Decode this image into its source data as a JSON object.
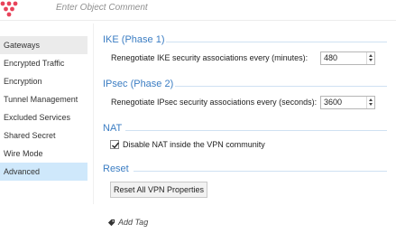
{
  "header": {
    "comment_placeholder": "Enter Object Comment"
  },
  "sidebar": {
    "items": [
      {
        "label": "Gateways",
        "state": "hover"
      },
      {
        "label": "Encrypted Traffic",
        "state": "normal"
      },
      {
        "label": "Encryption",
        "state": "normal"
      },
      {
        "label": "Tunnel Management",
        "state": "normal"
      },
      {
        "label": "Excluded Services",
        "state": "normal"
      },
      {
        "label": "Shared Secret",
        "state": "normal"
      },
      {
        "label": "Wire Mode",
        "state": "normal"
      },
      {
        "label": "Advanced",
        "state": "selected"
      }
    ]
  },
  "ike": {
    "title": "IKE (Phase 1)",
    "label": "Renegotiate IKE security associations every (minutes):",
    "value": "480"
  },
  "ipsec": {
    "title": "IPsec (Phase 2)",
    "label": "Renegotiate IPsec security associations every (seconds):",
    "value": "3600"
  },
  "nat": {
    "title": "NAT",
    "checkbox_label": "Disable NAT inside the VPN community",
    "checked": true
  },
  "reset": {
    "title": "Reset",
    "button_label": "Reset All VPN Properties"
  },
  "tags": {
    "add_label": "Add Tag"
  },
  "colors": {
    "accent": "#3b7dc3",
    "selected_bg": "#cfe8fb",
    "logo": "#e8435a"
  },
  "icons": {
    "logo": "checkpoint-logo-icon",
    "tag": "tag-icon",
    "check": "check-icon"
  }
}
